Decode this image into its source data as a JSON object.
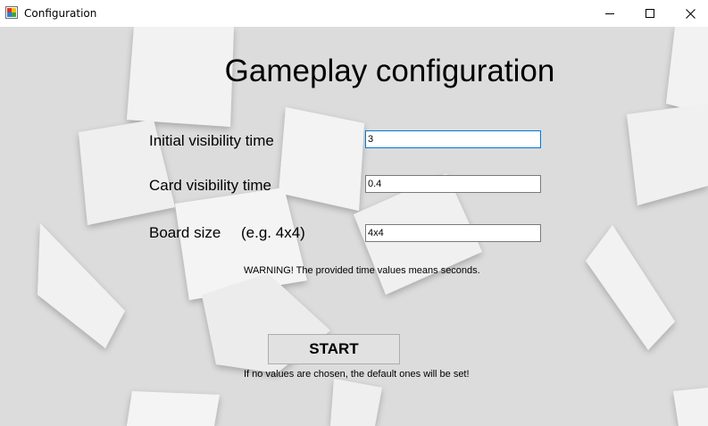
{
  "window": {
    "title": "Configuration",
    "minimize_icon": "minimize-icon",
    "maximize_icon": "maximize-icon",
    "close_icon": "close-icon"
  },
  "form": {
    "heading": "Gameplay configuration",
    "initial_visibility_label": "Initial visibility time",
    "initial_visibility_value": "3",
    "card_visibility_label": "Card visibility time",
    "card_visibility_value": "0.4",
    "board_size_label": "Board size",
    "board_size_hint": "(e.g. 4x4)",
    "board_size_value": "4x4",
    "warning": "WARNING! The provided time values means seconds.",
    "start_label": "START",
    "note": "If no values are chosen, the default ones will be set!"
  },
  "colors": {
    "background": "#dcdcdc",
    "focus_border": "#0078d7",
    "button_face": "#e1e1e1"
  }
}
